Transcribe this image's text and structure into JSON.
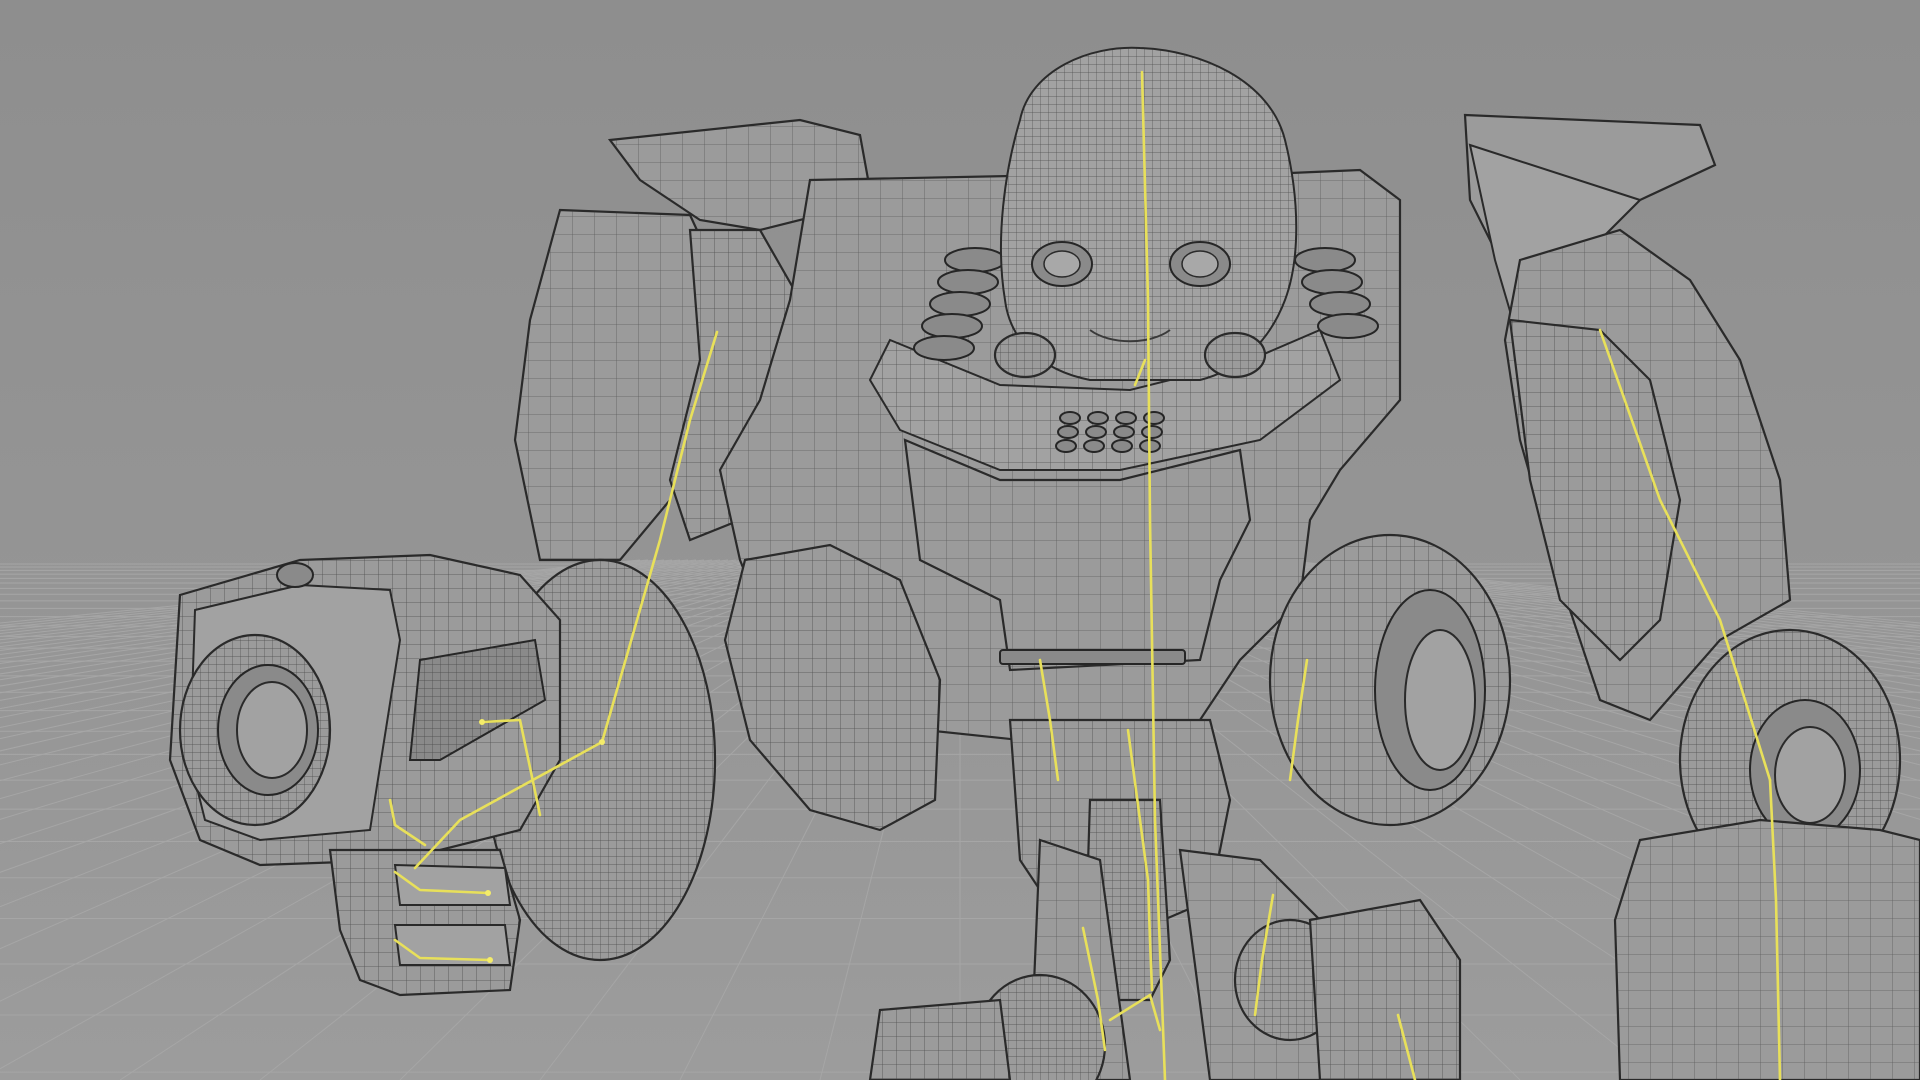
{
  "viewport": {
    "mode": "wireframe-on-shaded",
    "background_color": "#8f8f8f",
    "wire_color": "#2a2a2a",
    "bone_color": "#e8e05a",
    "grid": true
  },
  "model": {
    "subject": "robot",
    "visible_parts": [
      "head",
      "torso",
      "left-arm-cannon",
      "right-arm",
      "legs",
      "armature-bones"
    ]
  }
}
